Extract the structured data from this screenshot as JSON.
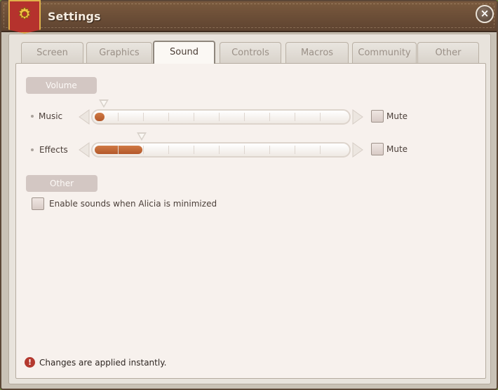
{
  "window": {
    "title": "Settings",
    "close_symbol": "×",
    "icon": "gear-icon",
    "accent_color": "#b5322d"
  },
  "tabs": [
    {
      "label": "Screen",
      "active": false
    },
    {
      "label": "Graphics",
      "active": false
    },
    {
      "label": "Sound",
      "active": true
    },
    {
      "label": "Controls",
      "active": false
    },
    {
      "label": "Macros",
      "active": false
    },
    {
      "label": "Community",
      "active": false
    },
    {
      "label": "Other",
      "active": false
    }
  ],
  "volume": {
    "header": "Volume",
    "music": {
      "label": "Music",
      "level_fraction": 0.03,
      "mute_label": "Mute",
      "muted": false
    },
    "effects": {
      "label": "Effects",
      "level_fraction": 0.19,
      "mute_label": "Mute",
      "muted": false
    }
  },
  "other": {
    "header": "Other",
    "minimized_sounds_label": "Enable sounds when Alicia is minimized",
    "minimized_sounds_checked": false
  },
  "footer": {
    "notice_icon": "!",
    "notice_text": "Changes are applied instantly."
  }
}
